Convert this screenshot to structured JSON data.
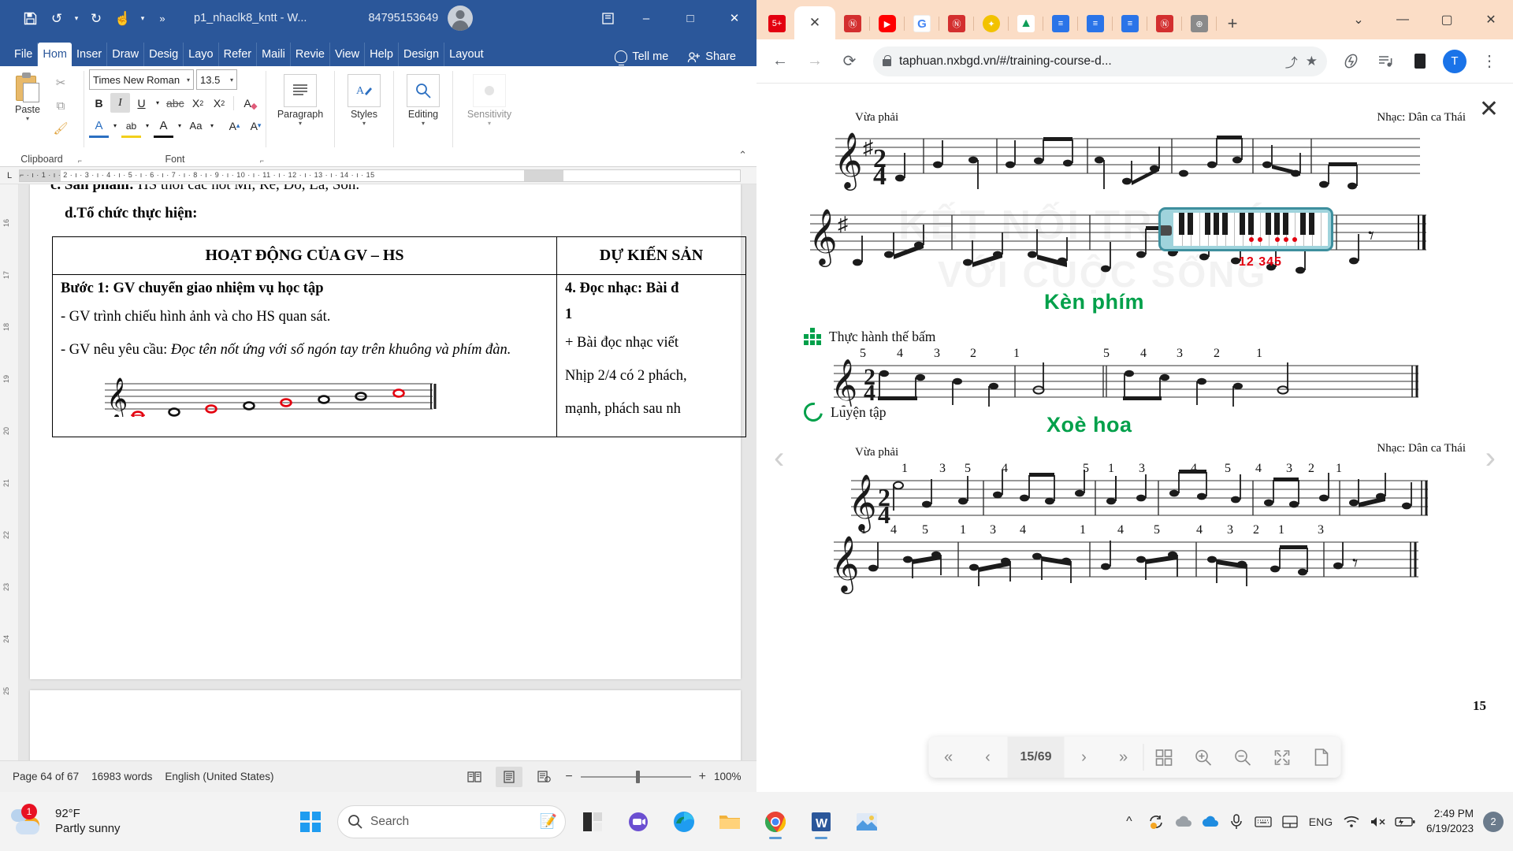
{
  "word": {
    "title": "p1_nhaclk8_kntt  -  W...",
    "account": "84795153649",
    "qat": {
      "save": "save-icon",
      "undo": "undo-icon",
      "redo": "redo-icon",
      "touch": "touch-mode-icon",
      "more": "more-icon"
    },
    "window_controls": {
      "ribbon": "ribbon-display-icon",
      "minimize": "–",
      "maximize": "□",
      "close": "✕"
    },
    "tabs": [
      "File",
      "Hom",
      "Inser",
      "Draw",
      "Desig",
      "Layo",
      "Refer",
      "Maili",
      "Revie",
      "View",
      "Help",
      "Design",
      "Layout"
    ],
    "active_tab": "Hom",
    "tell_me": "Tell me",
    "share": "Share",
    "ribbon": {
      "clipboard_label": "Clipboard",
      "paste_label": "Paste",
      "font_label": "Font",
      "font_name": "Times New Roman",
      "font_size": "13.5",
      "bold": "B",
      "italic": "I",
      "underline": "U",
      "strike": "abc",
      "subscript": "X",
      "superscript": "X",
      "clear_format": "A",
      "font_color": "A",
      "highlight": "ab",
      "text_color": "A",
      "change_case": "Aa",
      "grow_font": "A",
      "shrink_font": "A",
      "paragraph_label": "Paragraph",
      "styles_label": "Styles",
      "editing_label": "Editing",
      "sensitivity_label": "Sensitivity"
    },
    "ruler": {
      "horizontal": "⌐  ·  ı  ·  1  ·  ı  ·  2  ·  ı  ·  3  ·  ı  ·  4  ·  ı  ·  5  ·  ı  ·  6  ·  ı  ·  7  ·  ı  ·  8  ·  ı  ·  9  ·  ı  ·  10  ·  ı  ·  11  ·  ı  ·  12  ·  ı  ·  13  ·  ı  ·  14  ·  ı  ·  15",
      "vertical": [
        "16",
        "17",
        "18",
        "19",
        "20",
        "21",
        "22",
        "23",
        "24",
        "25"
      ]
    },
    "document": {
      "cut_line_bold": "c. Sản phẩm:",
      "cut_line_rest": " HS thổi các nốt Mi, Rê, Đô, La, Son.",
      "heading": "d.Tổ chức thực hiện:",
      "table": {
        "headers": [
          "HOẠT ĐỘNG CỦA GV – HS",
          "DỰ KIẾN SẢN"
        ],
        "left_cell": [
          "Bước 1: GV chuyển giao nhiệm vụ học tập",
          "- GV trình chiếu hình ảnh và cho HS quan sát.",
          "- GV nêu yêu cầu: Đọc tên nốt ứng với số ngón tay trên khuông và phím đàn."
        ],
        "left_cell_italic_from": "Đọc tên nốt ứng với số ngón tay trên khuông và phím đàn.",
        "right_cell": [
          "4. Đọc nhạc: Bài đ",
          "1",
          "+ Bài đọc nhạc viết ",
          "Nhịp 2/4 có 2 phách,",
          "mạnh, phách sau nh"
        ]
      }
    },
    "status": {
      "page": "Page 64 of 67",
      "words": "16983 words",
      "language": "English (United States)",
      "zoom": "100%",
      "zoom_out": "−",
      "zoom_in": "+",
      "views": [
        "read-mode-icon",
        "print-layout-icon",
        "web-layout-icon"
      ]
    }
  },
  "chrome": {
    "tabs": [
      {
        "name": "tab-zalo",
        "glyph": "5+",
        "color": "#e3000f",
        "active": false
      },
      {
        "name": "tab-active",
        "glyph": "✕",
        "color": "#444444",
        "active": true
      },
      {
        "name": "tab-nxbgd-1",
        "glyph": "Ⓝ",
        "color": "#d32f2f",
        "active": false
      },
      {
        "name": "tab-youtube",
        "glyph": "▶",
        "color": "#ff0000",
        "active": false
      },
      {
        "name": "tab-google",
        "glyph": "G",
        "color": "#4285f4",
        "active": false
      },
      {
        "name": "tab-nxbgd-2",
        "glyph": "Ⓝ",
        "color": "#d32f2f",
        "active": false
      },
      {
        "name": "tab-puzzle",
        "glyph": "✦",
        "color": "#f2c200",
        "active": false
      },
      {
        "name": "tab-google-drive",
        "glyph": "▲",
        "color": "#0f9d58",
        "active": false
      },
      {
        "name": "tab-google-docs-1",
        "glyph": "≡",
        "color": "#2a74e8",
        "active": false
      },
      {
        "name": "tab-google-docs-2",
        "glyph": "≡",
        "color": "#2a74e8",
        "active": false
      },
      {
        "name": "tab-google-docs-3",
        "glyph": "≡",
        "color": "#2a74e8",
        "active": false
      },
      {
        "name": "tab-nxbgd-3",
        "glyph": "Ⓝ",
        "color": "#d32f2f",
        "active": false
      },
      {
        "name": "tab-globe",
        "glyph": "🌐",
        "color": "#777777",
        "active": false
      }
    ],
    "new_tab": "+",
    "window_controls": {
      "tab_search": "⌄",
      "minimize": "—",
      "maximize": "▢",
      "close": "✕"
    },
    "toolbar": {
      "back": "←",
      "forward": "→",
      "reload": "⟳",
      "url": "taphuan.nxbgd.vn/#/training-course-d...",
      "share": "share-icon",
      "bookmark": "★",
      "extension": "extension-icon",
      "reading_list": "reading-list-icon",
      "device": "device-icon",
      "profile_initial": "T",
      "menu": "⋮"
    }
  },
  "pdf": {
    "watermark_lines": [
      "KẾT NỐI TRI THỨC",
      "VỚI CUỘC SỐNG"
    ],
    "page_number_label": "15",
    "top_score": {
      "tempo": "Vừa phải",
      "credit": "Nhạc: Dân ca Thái",
      "time_signature": "2/4"
    },
    "section_kenphim": {
      "title": "Kèn phím",
      "practice_label": "Thực hành thế bấm",
      "melodica_numbers": "12 345",
      "fingering_line": [
        "5",
        "4",
        "3",
        "2",
        "1",
        "5",
        "4",
        "3",
        "2",
        "1"
      ],
      "time_signature": "2/4"
    },
    "section_luyentap": {
      "label": "Luyện tập",
      "song_title": "Xoè hoa",
      "tempo": "Vừa phải",
      "credit": "Nhạc: Dân ca Thái",
      "time_signature": "2/4",
      "fingering_line1": [
        "1",
        "3",
        "5",
        "4",
        "5",
        "1",
        "3",
        "4",
        "5",
        "4",
        "3",
        "2",
        "1"
      ],
      "fingering_line2": [
        "1",
        "4",
        "5",
        "1",
        "3",
        "4",
        "1",
        "4",
        "5",
        "4",
        "3",
        "2",
        "1",
        "3"
      ]
    },
    "toolbar": {
      "first": "«",
      "prev": "‹",
      "page": "15/69",
      "next": "›",
      "last": "»",
      "thumbnails": "grid-icon",
      "zoom_in": "zoom-in-icon",
      "zoom_out": "zoom-out-icon",
      "fit": "fit-icon",
      "page_view": "page-view-icon"
    }
  },
  "taskbar": {
    "weather": {
      "temp": "92°F",
      "condition": "Partly sunny",
      "badge": "1"
    },
    "start": "windows-logo",
    "search_placeholder": "Search",
    "pinned": [
      {
        "name": "taskbar-widgets",
        "label": "widgets-icon"
      },
      {
        "name": "taskbar-teams",
        "label": "teams-icon"
      },
      {
        "name": "taskbar-edge",
        "label": "edge-icon"
      },
      {
        "name": "taskbar-file-explorer",
        "label": "file-explorer-icon"
      },
      {
        "name": "taskbar-chrome",
        "label": "chrome-icon"
      },
      {
        "name": "taskbar-word",
        "label": "word-icon"
      },
      {
        "name": "taskbar-photos",
        "label": "photos-icon"
      }
    ],
    "tray": {
      "overflow": "^",
      "icons": [
        "sync-icon",
        "onedrive-grey-icon",
        "onedrive-blue-icon",
        "microphone-icon",
        "keyboard-icon",
        "touchpad-icon"
      ],
      "language": "ENG",
      "network": "wifi-icon",
      "volume": "volume-muted-icon",
      "battery": "battery-icon",
      "time": "2:49 PM",
      "date": "6/19/2023",
      "notification_count": "2"
    }
  }
}
